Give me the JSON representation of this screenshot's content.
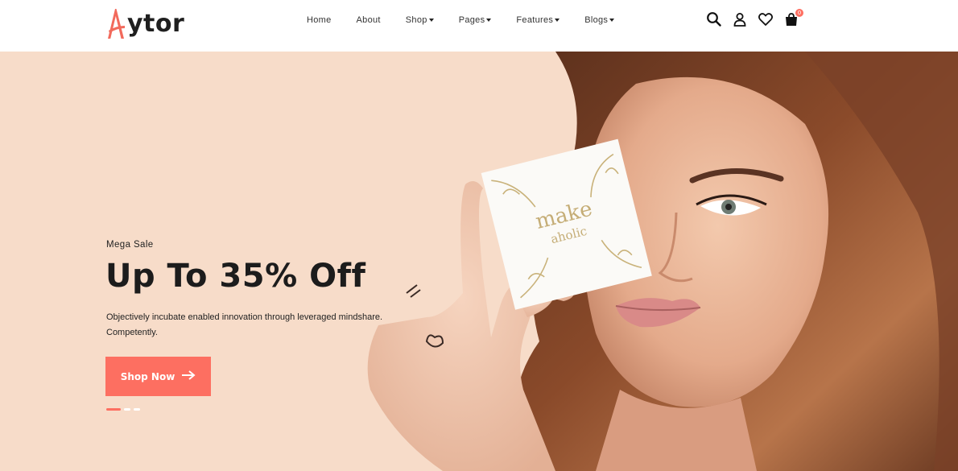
{
  "brand": {
    "logo_initial": "A",
    "logo_rest": "ytor",
    "accent_color": "#fd6f61"
  },
  "nav": {
    "items": [
      {
        "label": "Home",
        "has_dropdown": false
      },
      {
        "label": "About",
        "has_dropdown": false
      },
      {
        "label": "Shop",
        "has_dropdown": true
      },
      {
        "label": "Pages",
        "has_dropdown": true
      },
      {
        "label": "Features",
        "has_dropdown": true
      },
      {
        "label": "Blogs",
        "has_dropdown": true
      }
    ]
  },
  "header_icons": {
    "search": "search-icon",
    "account": "user-icon",
    "wishlist": "heart-icon",
    "cart": "shopping-bag-icon",
    "cart_count": "0"
  },
  "hero": {
    "eyebrow": "Mega Sale",
    "headline": "Up To 35% Off",
    "description_line1": "Objectively incubate enabled innovation through leveraged mindshare.",
    "description_line2": "Competently.",
    "cta_label": "Shop Now",
    "background_color": "#f7dcc9",
    "product_card_text_1": "make",
    "product_card_text_2": "aholic",
    "slides": 3,
    "active_slide": 1
  }
}
